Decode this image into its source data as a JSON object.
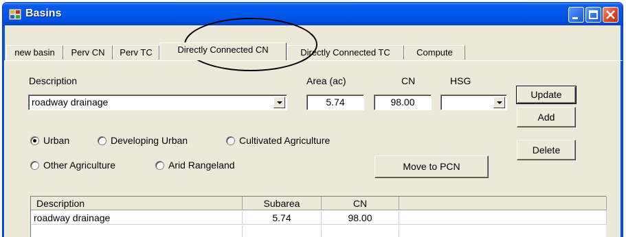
{
  "window": {
    "title": "Basins",
    "buttons": [
      "minimize",
      "maximize",
      "close"
    ]
  },
  "tabs": [
    "new basin",
    "Perv CN",
    "Perv TC",
    "Directly Connected CN",
    "Directly Connected TC",
    "Compute"
  ],
  "active_tab": "Directly Connected CN",
  "form": {
    "description_label": "Description",
    "description_value": "roadway drainage",
    "area_label": "Area (ac)",
    "area_value": "5.74",
    "cn_label": "CN",
    "cn_value": "98.00",
    "hsg_label": "HSG",
    "hsg_value": ""
  },
  "buttons": {
    "update": "Update",
    "add": "Add",
    "delete": "Delete",
    "move_to_pcn": "Move to PCN"
  },
  "land_use": {
    "options": [
      "Urban",
      "Developing Urban",
      "Cultivated Agriculture",
      "Other Agriculture",
      "Arid Rangeland"
    ],
    "selected": "Urban"
  },
  "table": {
    "columns": [
      "Description",
      "Subarea",
      "CN"
    ],
    "rows": [
      [
        "roadway drainage",
        "5.74",
        "98.00"
      ]
    ]
  }
}
